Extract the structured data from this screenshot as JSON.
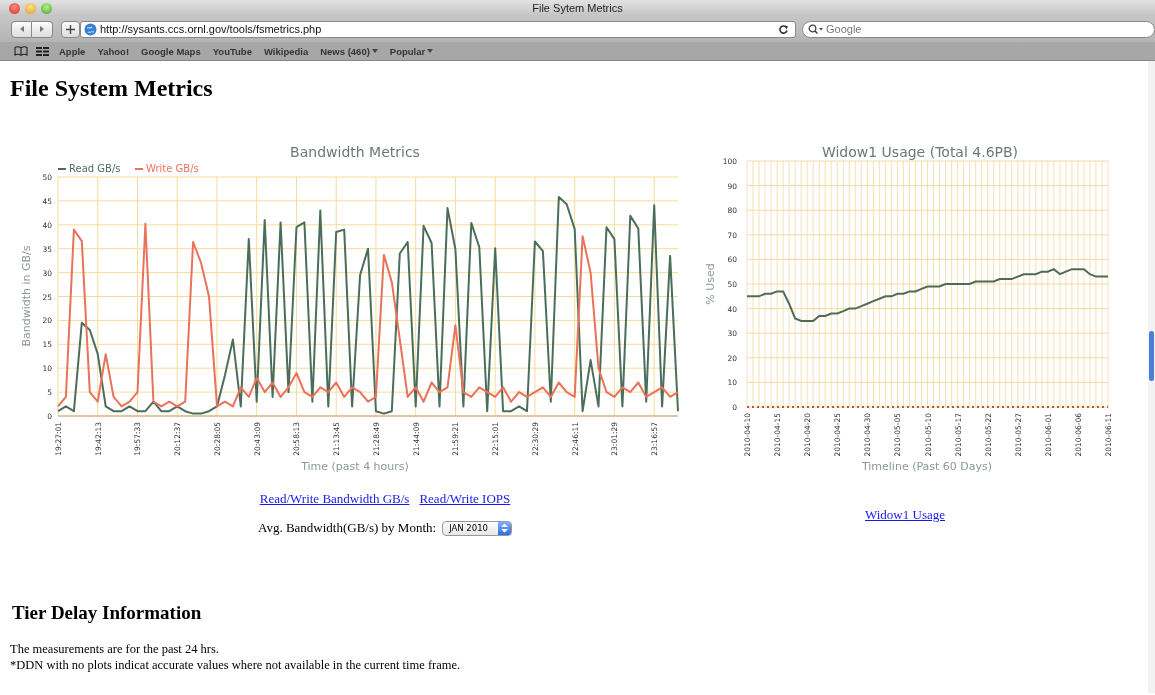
{
  "window": {
    "title": "File Sytem Metrics"
  },
  "toolbar": {
    "url": "http://sysants.ccs.ornl.gov/tools/fsmetrics.php",
    "search": {
      "placeholder": "Google"
    }
  },
  "bookmarks": [
    {
      "label": "Apple",
      "menu": false
    },
    {
      "label": "Yahoo!",
      "menu": false
    },
    {
      "label": "Google Maps",
      "menu": false
    },
    {
      "label": "YouTube",
      "menu": false
    },
    {
      "label": "Wikipedia",
      "menu": false
    },
    {
      "label": "News (460)",
      "menu": true
    },
    {
      "label": "Popular",
      "menu": true
    }
  ],
  "page": {
    "title": "File System Metrics",
    "bandwidth_chart": {
      "chart_data": {
        "type": "line",
        "title": "Bandwidth Metrics",
        "xlabel": "Time (past 4 hours)",
        "ylabel": "Bandwidth in GB/s",
        "categories": [
          "19:27:01",
          null,
          null,
          null,
          null,
          "19:42:13",
          null,
          null,
          null,
          null,
          "19:57:33",
          null,
          null,
          null,
          null,
          "20:12:37",
          null,
          null,
          null,
          null,
          "20:28:05",
          null,
          null,
          null,
          null,
          "20:43:09",
          null,
          null,
          null,
          null,
          "20:58:13",
          null,
          null,
          null,
          null,
          "21:13:45",
          null,
          null,
          null,
          null,
          "21:28:49",
          null,
          null,
          null,
          null,
          "21:44:09",
          null,
          null,
          null,
          null,
          "21:59:21",
          null,
          null,
          null,
          null,
          "22:15:01",
          null,
          null,
          null,
          null,
          "22:30:29",
          null,
          null,
          null,
          null,
          "22:46:11",
          null,
          null,
          null,
          null,
          "23:01:29",
          null,
          null,
          null,
          null,
          "23:16:57",
          null,
          null,
          null
        ],
        "series": [
          {
            "name": "Read GB/s",
            "color": "#4a6e5a",
            "values": [
              1,
              2,
              1,
              19.5,
              18,
              13,
              2,
              1,
              1,
              2,
              1,
              1,
              3,
              1,
              1,
              2,
              1,
              0.5,
              0.5,
              1,
              2,
              8.5,
              16,
              2,
              37,
              3,
              41,
              4,
              40.5,
              5,
              39.5,
              40.5,
              3,
              43,
              2,
              38.5,
              39,
              2,
              29.5,
              35,
              1,
              0.5,
              1,
              34,
              36.4,
              2,
              39.8,
              36.2,
              2,
              43.5,
              34.9,
              2,
              40.4,
              35.3,
              1,
              35.1,
              1,
              1,
              2,
              1,
              36.5,
              34.5,
              3,
              45.8,
              44.3,
              39.1,
              1,
              11.7,
              2,
              39.5,
              37,
              2,
              41.9,
              39.2,
              3,
              44.1,
              2,
              33.5,
              1
            ]
          },
          {
            "name": "Write GB/s",
            "color": "#e8735a",
            "values": [
              2,
              4,
              39,
              36.6,
              5,
              3,
              12.9,
              4,
              2,
              3,
              5,
              40.2,
              3,
              2,
              3,
              2,
              3,
              36.4,
              32,
              25,
              2,
              3,
              2,
              6,
              4,
              8,
              5,
              7,
              4,
              6,
              9,
              5,
              4,
              6,
              5,
              7,
              4,
              6,
              5,
              3,
              4,
              33.7,
              28,
              16,
              4,
              6,
              3,
              7,
              5,
              6,
              19,
              5,
              4,
              6,
              5,
              4,
              6,
              3,
              5,
              4,
              5,
              6,
              4,
              7,
              5,
              4,
              37.6,
              30,
              10,
              5,
              4,
              6,
              5,
              7,
              4,
              5,
              6,
              4,
              5
            ]
          }
        ],
        "ylim": [
          0,
          50
        ],
        "grid": true,
        "legend": "top-left",
        "yticks": [
          0,
          5,
          10,
          15,
          20,
          25,
          30,
          35,
          40,
          45,
          50
        ]
      }
    },
    "bandwidth_links": [
      "Read/Write Bandwidth GB/s",
      "Read/Write IOPS"
    ],
    "month_filter": {
      "label": "Avg. Bandwidth(GB/s) by Month:",
      "value": "JAN 2010"
    },
    "usage_chart": {
      "chart_data": {
        "type": "line",
        "title": "Widow1 Usage (Total 4.6PB)",
        "xlabel": "Timeline (Past 60 Days)",
        "ylabel": "% Used",
        "categories": [
          "2010-04-10",
          null,
          null,
          null,
          null,
          "2010-04-15",
          null,
          null,
          null,
          null,
          "2010-04-20",
          null,
          null,
          null,
          null,
          "2010-04-25",
          null,
          null,
          null,
          null,
          "2010-04-30",
          null,
          null,
          null,
          null,
          "2010-05-05",
          null,
          null,
          null,
          null,
          "2010-05-10",
          null,
          null,
          null,
          null,
          "2010-05-17",
          null,
          null,
          null,
          null,
          "2010-05-22",
          null,
          null,
          null,
          null,
          "2010-05-27",
          null,
          null,
          null,
          null,
          "2010-06-01",
          null,
          null,
          null,
          null,
          "2010-06-06",
          null,
          null,
          null,
          null,
          "2010-06-11"
        ],
        "series": [
          {
            "color": "#4f6b55",
            "values": [
              45,
              45,
              45,
              46,
              46,
              47,
              47,
              42,
              36,
              35,
              35,
              35,
              37,
              37,
              38,
              38,
              39,
              40,
              40,
              41,
              42,
              43,
              44,
              45,
              45,
              46,
              46,
              47,
              47,
              48,
              49,
              49,
              49,
              50,
              50,
              50,
              50,
              50,
              51,
              51,
              51,
              51,
              52,
              52,
              52,
              53,
              54,
              54,
              54,
              55,
              55,
              56,
              54,
              55,
              56,
              56,
              56,
              54,
              53,
              53,
              53
            ]
          }
        ],
        "ylim": [
          0,
          100
        ],
        "grid": true,
        "yticks": [
          0,
          10,
          20,
          30,
          40,
          50,
          60,
          70,
          80,
          90,
          100
        ]
      }
    },
    "usage_link": "Widow1 Usage",
    "tier_delay": {
      "heading": "Tier Delay Information",
      "lines": [
        "The measurements are for the past 24 hrs.",
        "*DDN with no plots indicat accurate values where not available in the current time frame."
      ]
    }
  }
}
